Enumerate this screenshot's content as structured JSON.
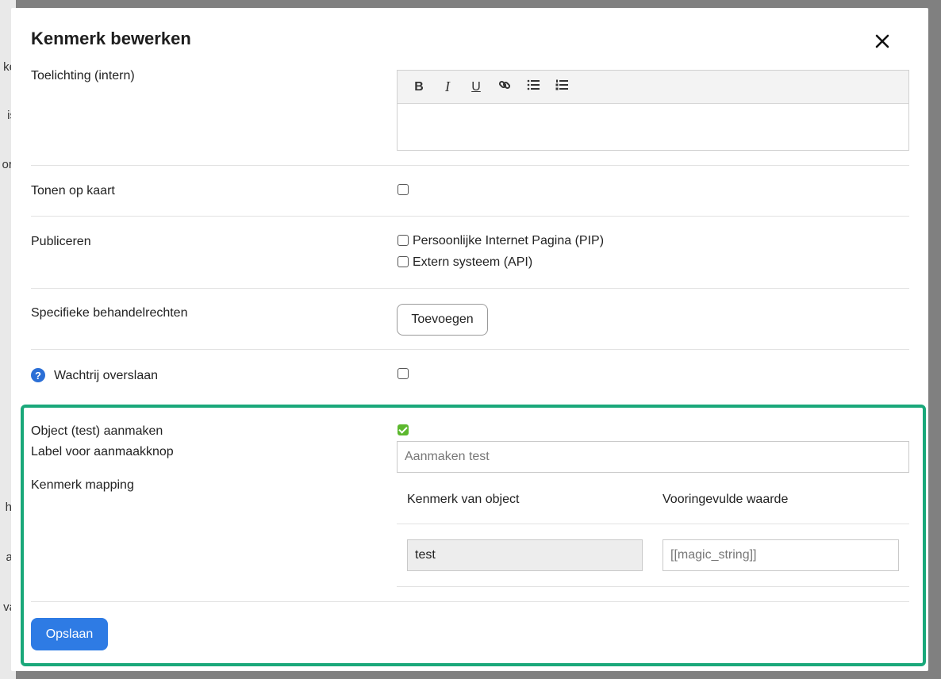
{
  "background": {
    "fragments": [
      "ke",
      "is",
      "ort",
      "hr",
      "at",
      "va"
    ]
  },
  "modal": {
    "title": "Kenmerk bewerken",
    "close_icon": "close-icon"
  },
  "fields": {
    "toelichting_label": "Toelichting (intern)",
    "editor_toolbar": [
      "B",
      "I",
      "U",
      "link-icon",
      "bullet-list-icon",
      "numbered-list-icon"
    ],
    "tonen_label": "Tonen op kaart",
    "publiceren_label": "Publiceren",
    "publiceren_options": [
      "Persoonlijke Internet Pagina (PIP)",
      "Extern systeem (API)"
    ],
    "behandelrechten_label": "Specifieke behandelrechten",
    "toevoegen_button": "Toevoegen",
    "wachtrij_label": "Wachtrij overslaan"
  },
  "object_section": {
    "object_label": "Object (test) aanmaken",
    "object_checked": true,
    "knop_label": "Label voor aanmaakknop",
    "knop_placeholder": "Aanmaken test",
    "mapping_label": "Kenmerk mapping",
    "mapping_headers": [
      "Kenmerk van object",
      "Vooringevulde waarde"
    ],
    "mapping_rows": [
      {
        "kenmerk": "test",
        "waarde_placeholder": "[[magic_string]]"
      }
    ]
  },
  "footer": {
    "save_label": "Opslaan"
  },
  "colors": {
    "highlight": "#1aa87a",
    "primary": "#2e7be4",
    "checkbox_checked": "#5cb82e",
    "help_icon": "#2b6fd6"
  }
}
